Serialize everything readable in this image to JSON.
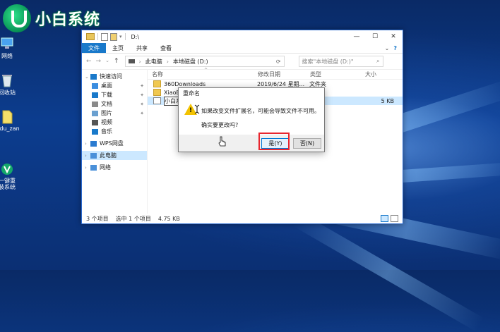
{
  "logo": {
    "text": "小白系统"
  },
  "desktop": {
    "icons": [
      {
        "label": "网络",
        "icon": "network-icon"
      },
      {
        "label": "回收站",
        "icon": "recycle-bin-icon"
      },
      {
        "label": "aidu_zan",
        "icon": "file-icon"
      },
      {
        "label": "一键重\n装系统",
        "icon": "reinstall-icon"
      }
    ]
  },
  "window": {
    "title": "D:\\",
    "ribbon": {
      "tabs": [
        "文件",
        "主页",
        "共享",
        "查看"
      ]
    },
    "breadcrumb": [
      "此电脑",
      "本地磁盘 (D:)"
    ],
    "search_placeholder": "搜索\"本地磁盘 (D:)\"",
    "sidebar": [
      {
        "label": "快速访问",
        "level": 0,
        "icon": "star-icon",
        "chevron": "v"
      },
      {
        "label": "桌面",
        "level": 1,
        "icon": "desktop-folder-icon",
        "pinned": true
      },
      {
        "label": "下载",
        "level": 1,
        "icon": "download-icon",
        "pinned": true
      },
      {
        "label": "文档",
        "level": 1,
        "icon": "documents-icon",
        "pinned": true
      },
      {
        "label": "图片",
        "level": 1,
        "icon": "pictures-icon",
        "pinned": true
      },
      {
        "label": "视频",
        "level": 1,
        "icon": "videos-icon"
      },
      {
        "label": "音乐",
        "level": 1,
        "icon": "music-icon"
      },
      {
        "label": "WPS网盘",
        "level": 0,
        "icon": "cloud-icon",
        "chevron": ">"
      },
      {
        "label": "此电脑",
        "level": 0,
        "icon": "computer-icon",
        "chevron": ">",
        "selected": true
      },
      {
        "label": "网络",
        "level": 0,
        "icon": "network-icon",
        "chevron": ">"
      }
    ],
    "columns": {
      "name": "名称",
      "date": "修改日期",
      "type": "类型",
      "size": "大小"
    },
    "files": [
      {
        "name": "360Downloads",
        "date": "2019/6/24 星期...",
        "type": "文件夹",
        "size": ""
      },
      {
        "name": "XiaoBai",
        "date": "",
        "type": "",
        "size": ""
      },
      {
        "name": "小白系统",
        "date": "",
        "type": "文档",
        "size": "5 KB",
        "selected": true
      }
    ],
    "status": {
      "count": "3 个项目",
      "selection": "选中 1 个项目",
      "size": "4.75 KB"
    }
  },
  "dialog": {
    "title": "重命名",
    "message": "如果改变文件扩展名，可能会导致文件不可用。",
    "question": "确实要更改吗?",
    "yes": "是(Y)",
    "no": "否(N)"
  }
}
